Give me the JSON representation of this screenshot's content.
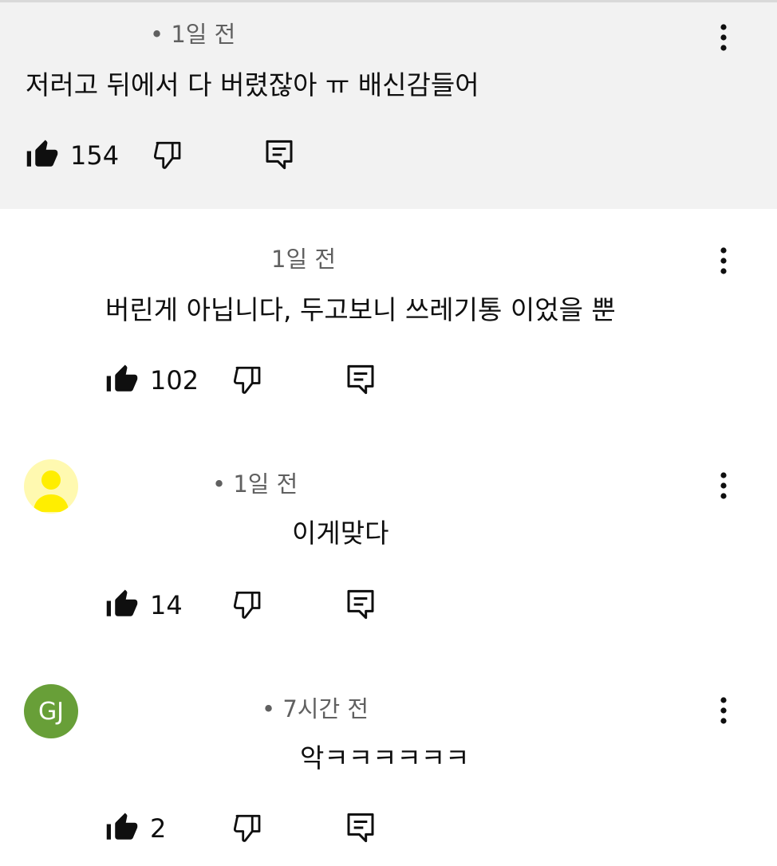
{
  "comments": [
    {
      "time": "• 1일 전",
      "text": "저러고 뒤에서 다 버렸잖아 ㅠ 배신감들어",
      "likes": "154"
    },
    {
      "time": "1일 전",
      "text": "버린게 아닙니다, 두고보니 쓰레기통 이었을 뿐",
      "likes": "102"
    },
    {
      "time": "• 1일 전",
      "text": "이게맞다",
      "likes": "14"
    },
    {
      "avatar_initials": "GJ",
      "time": "• 7시간 전",
      "text": "악ㅋㅋㅋㅋㅋㅋ",
      "likes": "2"
    }
  ],
  "colors": {
    "highlight_bg": "#f2f2f2",
    "avatar_yellow": "#ffee00",
    "avatar_green": "#689f38",
    "meta_text": "#606060"
  },
  "icons": [
    "thumbs-up-icon",
    "thumbs-down-icon",
    "reply-icon",
    "more-vert-icon",
    "person-icon"
  ]
}
